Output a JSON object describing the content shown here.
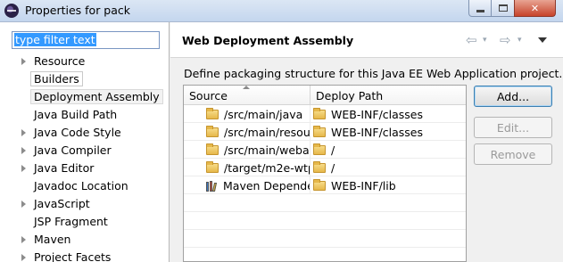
{
  "window": {
    "title": "Properties for pack"
  },
  "filter": {
    "value": "type filter text"
  },
  "tree": {
    "items": [
      {
        "label": "Resource",
        "expandable": true
      },
      {
        "label": "Builders",
        "expandable": false
      },
      {
        "label": "Deployment Assembly",
        "expandable": false
      },
      {
        "label": "Java Build Path",
        "expandable": false
      },
      {
        "label": "Java Code Style",
        "expandable": true
      },
      {
        "label": "Java Compiler",
        "expandable": true
      },
      {
        "label": "Java Editor",
        "expandable": true
      },
      {
        "label": "Javadoc Location",
        "expandable": false
      },
      {
        "label": "JavaScript",
        "expandable": true
      },
      {
        "label": "JSP Fragment",
        "expandable": false
      },
      {
        "label": "Maven",
        "expandable": true
      },
      {
        "label": "Project Facets",
        "expandable": true
      }
    ]
  },
  "page": {
    "title": "Web Deployment Assembly",
    "description": "Define packaging structure for this Java EE Web Application project."
  },
  "table": {
    "columns": [
      "Source",
      "Deploy Path"
    ],
    "rows": [
      {
        "source": "/src/main/java",
        "source_icon": "folder-icon",
        "deploy": "WEB-INF/classes"
      },
      {
        "source": "/src/main/resour",
        "source_icon": "folder-icon",
        "deploy": "WEB-INF/classes"
      },
      {
        "source": "/src/main/webap",
        "source_icon": "folder-icon",
        "deploy": "/"
      },
      {
        "source": "/target/m2e-wtp",
        "source_icon": "folder-icon",
        "deploy": "/"
      },
      {
        "source": "Maven Depende",
        "source_icon": "library-icon",
        "deploy": "WEB-INF/lib"
      }
    ]
  },
  "buttons": {
    "add": "Add...",
    "edit": "Edit...",
    "remove": "Remove"
  }
}
